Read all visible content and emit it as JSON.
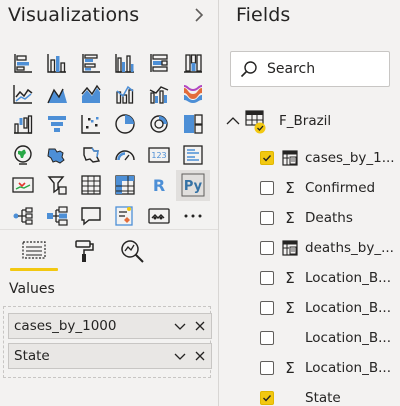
{
  "visualizations": {
    "title": "Visualizations",
    "icons": [
      [
        "stacked-bar-chart-icon",
        "stacked-column-chart-icon",
        "clustered-bar-chart-icon",
        "clustered-column-chart-icon",
        "100-stacked-bar-chart-icon",
        "100-stacked-column-chart-icon"
      ],
      [
        "line-chart-icon",
        "area-chart-icon",
        "stacked-area-chart-icon",
        "line-and-stacked-column-chart-icon",
        "line-and-clustered-column-chart-icon",
        "ribbon-chart-icon"
      ],
      [
        "waterfall-chart-icon",
        "funnel-chart-icon",
        "scatter-chart-icon",
        "pie-chart-icon",
        "donut-chart-icon",
        "treemap-icon"
      ],
      [
        "map-icon",
        "filled-map-icon",
        "shape-map-icon",
        "gauge-icon",
        "card-icon",
        "multi-row-card-icon"
      ],
      [
        "kpi-icon",
        "slicer-icon",
        "table-icon",
        "matrix-icon",
        "r-script-visual-icon",
        "python-visual-icon"
      ],
      [
        "key-influencers-icon",
        "decomposition-tree-icon",
        "qa-visual-icon",
        "smart-narrative-icon",
        "paginated-report-icon",
        "more-visuals-icon"
      ]
    ],
    "selected_icon": "python-visual-icon",
    "tabs": [
      "fields-tab-icon",
      "format-paint-roller-icon",
      "analytics-magnifier-icon"
    ],
    "values_label": "Values",
    "well_fields": [
      {
        "label": "cases_by_1000"
      },
      {
        "label": "State"
      }
    ],
    "accent": "#f2c811"
  },
  "fields": {
    "title": "Fields",
    "search_placeholder": "Search",
    "table_name": "F_Brazil",
    "items": [
      {
        "label": "cases_by_1...",
        "checked": true,
        "type": "calc-table-icon"
      },
      {
        "label": "Confirmed",
        "checked": false,
        "type": "sigma-icon"
      },
      {
        "label": "Deaths",
        "checked": false,
        "type": "sigma-icon"
      },
      {
        "label": "deaths_by_...",
        "checked": false,
        "type": "calc-table-icon"
      },
      {
        "label": "Location_B...",
        "checked": false,
        "type": "sigma-icon"
      },
      {
        "label": "Location_B...",
        "checked": false,
        "type": "sigma-icon"
      },
      {
        "label": "Location_B...",
        "checked": false,
        "type": "none"
      },
      {
        "label": "Location_B...",
        "checked": false,
        "type": "sigma-icon"
      },
      {
        "label": "State",
        "checked": true,
        "type": "none"
      }
    ]
  }
}
